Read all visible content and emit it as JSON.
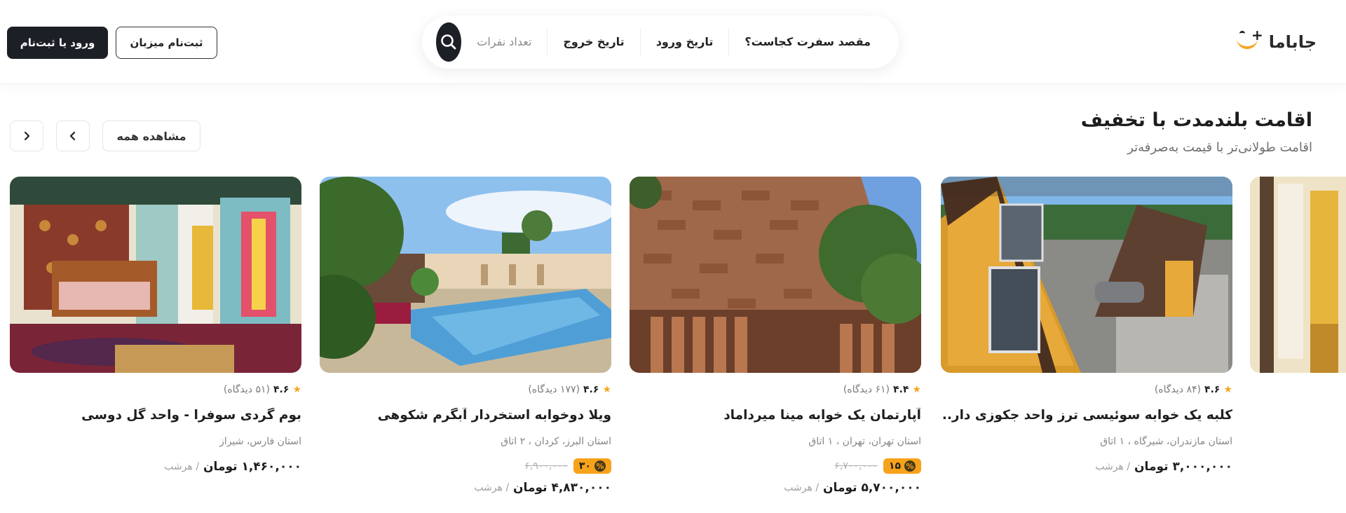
{
  "header": {
    "logo_text": "جاباما",
    "search": {
      "destination": "مقصد سفرت کجاست؟",
      "check_in": "تاریخ ورود",
      "check_out": "تاریخ خروج",
      "guests": "تعداد نفرات"
    },
    "host_signup": "ثبت‌نام میزبان",
    "login": "ورود یا ثبت‌نام"
  },
  "section": {
    "title": "اقامت بلندمدت با تخفیف",
    "subtitle": "اقامت طولانی‌تر با قیمت به‌صرفه‌تر",
    "view_all": "مشاهده همه"
  },
  "cards": [
    {
      "score": "۴.۶",
      "reviews": "(۸۴ دیدگاه)",
      "title": "کلبه یک خوابه سوئیسی ترز واحد جکوزی دار...",
      "location": "استان مازندران، شیرگاه ، ۱ اتاق",
      "price": "۳,۰۰۰,۰۰۰ تومان",
      "per": "/ هرشب"
    },
    {
      "score": "۴.۴",
      "reviews": "(۶۱ دیدگاه)",
      "title": "آپارتمان یک خوابه مینا میرداماد",
      "location": "استان تهران، تهران ، ۱ اتاق",
      "discount": "۱۵",
      "old_price": "۶,۷۰۰,۰۰۰",
      "price": "۵,۷۰۰,۰۰۰ تومان",
      "per": "/ هرشب"
    },
    {
      "score": "۴.۶",
      "reviews": "(۱۷۷ دیدگاه)",
      "title": "ویلا دوخوابه استخردار آبگرم شکوهی",
      "location": "استان البرز، کردان ، ۲ اتاق",
      "discount": "۳۰",
      "old_price": "۶,۹۰۰,۰۰۰",
      "price": "۴,۸۳۰,۰۰۰ تومان",
      "per": "/ هرشب"
    },
    {
      "score": "۴.۶",
      "reviews": "(۵۱ دیدگاه)",
      "title": "بوم گردی سوفرا - واحد گل دوسی",
      "location": "استان فارس، شیراز",
      "price": "۱,۴۶۰,۰۰۰ تومان",
      "per": "/ هرشب"
    }
  ],
  "colors": {
    "accent": "#f7a21b",
    "dark": "#1c1f26",
    "star": "#f5a623"
  }
}
